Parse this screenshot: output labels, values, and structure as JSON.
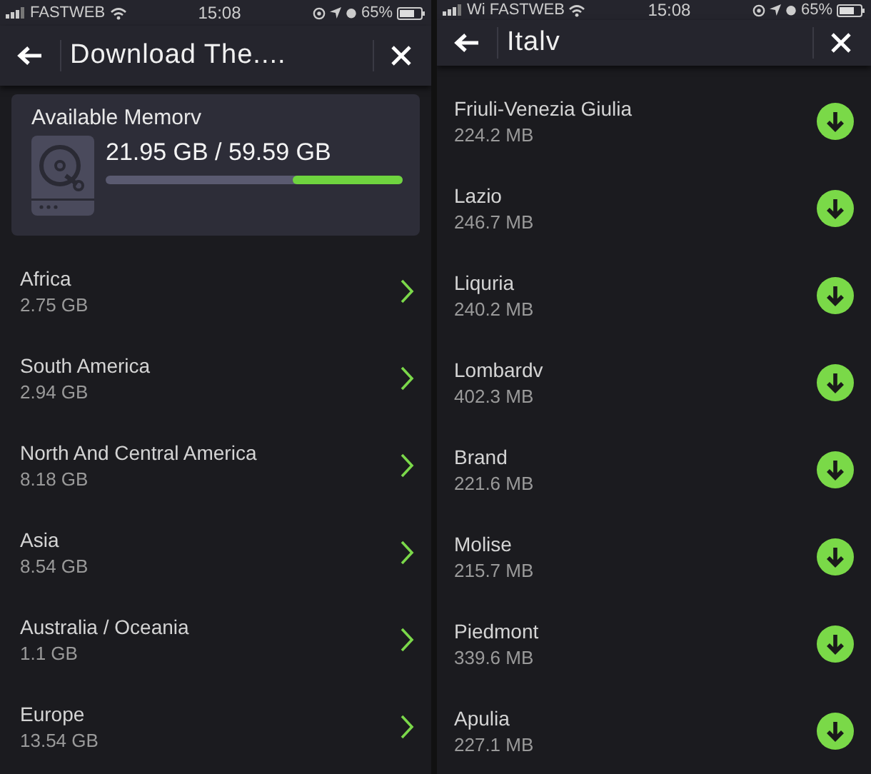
{
  "screens": [
    {
      "status_bar": {
        "carrier": "FASTWEB",
        "time": "15:08",
        "battery": "65%"
      },
      "header": {
        "title": "Download The...."
      },
      "memory": {
        "label": "Available Memorv",
        "reading": "21.95 GB / 59.59 GB",
        "level": 0.37
      },
      "items": [
        {
          "kind": "folder",
          "name": "Africa",
          "size": "2.75 GB"
        },
        {
          "kind": "folder",
          "name": "South America",
          "size": "2.94 GB"
        },
        {
          "kind": "folder",
          "name": "North And Central America",
          "size": "8.18 GB"
        },
        {
          "kind": "folder",
          "name": "Asia",
          "size": "8.54 GB"
        },
        {
          "kind": "folder",
          "name": "Australia / Oceania",
          "size": "1.1 GB"
        },
        {
          "kind": "folder",
          "name": "Europe",
          "size": "13.54 GB"
        }
      ]
    },
    {
      "status_bar": {
        "carrier": "Wi FASTWEB",
        "time": "15:08",
        "battery": "65%"
      },
      "header": {
        "title": "Italv"
      },
      "items": [
        {
          "kind": "download",
          "name": "Friuli-Venezia Giulia",
          "size": "224.2 MB"
        },
        {
          "kind": "download",
          "name": "Lazio",
          "size": "246.7 MB"
        },
        {
          "kind": "download",
          "name": "Liquria",
          "size": "240.2 MB"
        },
        {
          "kind": "download",
          "name": "Lombardv",
          "size": "402.3 MB"
        },
        {
          "kind": "download",
          "name": "Brand",
          "size": "221.6 MB"
        },
        {
          "kind": "download",
          "name": "Molise",
          "size": "215.7 MB"
        },
        {
          "kind": "download",
          "name": "Piedmont",
          "size": "339.6 MB"
        },
        {
          "kind": "download",
          "name": "Apulia",
          "size": "227.1 MB"
        }
      ]
    }
  ]
}
